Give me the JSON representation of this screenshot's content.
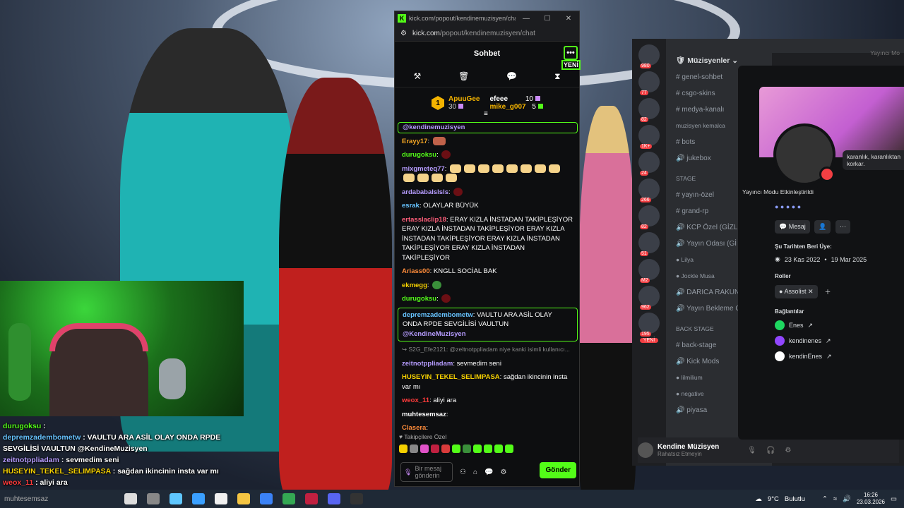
{
  "chat_window": {
    "title": "kick.com/popout/kendinemuzisyen/chat - ...",
    "url_host": "kick.com",
    "url_path": "/popout/kendinemuzisyen/chat",
    "header_title": "Sohbet",
    "new_badge": "YENİ",
    "more_icon": "more-dots-icon",
    "leaderboard": [
      {
        "name": "ApuuGee",
        "value": "30",
        "rank": "1"
      },
      {
        "name": "efeee",
        "value": "10"
      },
      {
        "name": "mike_g007",
        "value": "5"
      }
    ],
    "pinned_mention": "@kendinemuzisyen",
    "messages": [
      {
        "user": "Erayy17",
        "color": "#f5a623",
        "text": "",
        "emote": "img"
      },
      {
        "user": "durugoksu",
        "color": "#53fc18",
        "text": "",
        "emote": "red"
      },
      {
        "user": "mixgmeteq77",
        "color": "#b69cff",
        "text": "",
        "emote": "duck"
      },
      {
        "user": "ardababalslsls",
        "color": "#b69cff",
        "text": "",
        "emote": "red"
      },
      {
        "user": "esrak",
        "color": "#67c3ff",
        "text": "OLAYLAR BÜYÜK",
        "emote": ""
      },
      {
        "user": "ertasslaclip18",
        "color": "#ff5e7a",
        "text": "ERAY KIZLA İNSTADAN TAKİPLEŞİYOR ERAY KIZLA İNSTADAN TAKİPLEŞİYOR ERAY KIZLA İNSTADAN TAKİPLEŞİYOR ERAY KIZLA İNSTADAN TAKİPLEŞİYOR ERAY KIZLA İNSTADAN TAKİPLEŞİYOR",
        "emote": ""
      },
      {
        "user": "Ariass00",
        "color": "#ff8c3a",
        "text": "KNGLL SOCİAL BAK",
        "emote": ""
      },
      {
        "user": "ekmegg",
        "color": "#f5d000",
        "text": "",
        "emote": "pepe"
      },
      {
        "user": "durugoksu",
        "color": "#53fc18",
        "text": "",
        "emote": "red"
      }
    ],
    "highlight_message": {
      "user": "depremzadembometw",
      "text": "VAULTU ARA ASİL OLAY ONDA RPDE SEVGİLİSİ VAULTUN",
      "mention": "@KendineMuzisyen"
    },
    "reply_line": "S2G_Efe2121: @zeltnotppliadam niye kanki isimli kullanıcı...",
    "messages2": [
      {
        "user": "zeitnotppliadam",
        "color": "#b69cff",
        "text": "sevmedim seni"
      },
      {
        "user": "HUSEYIN_TEKEL_SELIMPASA",
        "color": "#f5d000",
        "text": "sağdan ikincinin insta var mı"
      },
      {
        "user": "weox_11",
        "color": "#ff3b3b",
        "text": "aliyi ara"
      },
      {
        "user": "muhtesemsaz",
        "color": "#ffffff",
        "text": ""
      },
      {
        "user": "Clasera",
        "color": "#ff8c3a",
        "text": ""
      }
    ],
    "followers_label": "Takipçilere Özel",
    "input_placeholder": "Bir mesaj gönderin",
    "send_label": "Gönder"
  },
  "stream_overlay": [
    {
      "user": "durugoksu",
      "color": "#53fc18",
      "text": ""
    },
    {
      "user": "depremzadembometw",
      "color": "#67c3ff",
      "text": "VAULTU ARA ASİL OLAY ONDA RPDE SEVGİLİSİ VAULTUN @KendineMuzisyen"
    },
    {
      "user": "zeitnotppliadam",
      "color": "#b69cff",
      "text": "sevmedim seni"
    },
    {
      "user": "HUSEYIN_TEKEL_SELIMPASA",
      "color": "#f5d000",
      "text": "sağdan ikincinin insta var mı"
    },
    {
      "user": "weox_11",
      "color": "#ff3b3b",
      "text": "aliyi ara"
    },
    {
      "user": "muhtesemsaz",
      "color": "#ffffff",
      "text": ""
    }
  ],
  "discord": {
    "server_name": "Müzisyenler",
    "top_hint": "Yayıncı Mo",
    "channels": [
      {
        "name": "genel-sohbet",
        "type": "text"
      },
      {
        "name": "csgo-skins",
        "type": "text"
      },
      {
        "name": "medya-kanalı",
        "type": "text"
      },
      {
        "name": "muzisyen kemalca",
        "type": "sub"
      },
      {
        "name": "bots",
        "type": "text"
      },
      {
        "name": "jukebox",
        "type": "voice"
      },
      {
        "name": "STAGE",
        "type": "cat"
      },
      {
        "name": "yayın-özel",
        "type": "text"
      },
      {
        "name": "grand-rp",
        "type": "text"
      },
      {
        "name": "KCP Özel (GİZL",
        "type": "voice"
      },
      {
        "name": "Yayın Odası (Gİ",
        "type": "voice"
      },
      {
        "name": "Lilya",
        "type": "member"
      },
      {
        "name": "Jockle Musa",
        "type": "member"
      },
      {
        "name": "DARICA RAKUN",
        "type": "voice"
      },
      {
        "name": "Yayın Bekleme O",
        "type": "voice"
      },
      {
        "name": "BACK STAGE",
        "type": "cat"
      },
      {
        "name": "back-stage",
        "type": "text"
      },
      {
        "name": "Kick Mods",
        "type": "voice"
      },
      {
        "name": "lilmilium",
        "type": "member"
      },
      {
        "name": "negative",
        "type": "member"
      },
      {
        "name": "piyasa",
        "type": "voice"
      }
    ],
    "server_badges": [
      "980",
      "77",
      "82",
      "1K+",
      "24",
      "266",
      "82",
      "51",
      "M2",
      "962",
      "195"
    ],
    "yeni_badge": "YENİ",
    "user_name": "Kendine Müzisyen",
    "user_status": "Rahatsız Etmeyin",
    "profile": {
      "bubble": "karanlık, karanlıktan korkar.",
      "tooltip": "Yayıncı Modu Etkinleştirildi",
      "message_btn": "Mesaj",
      "member_since_label": "Şu Tarihten Beri Üye:",
      "since_discord": "23 Kas 2022",
      "since_server": "19 Mar 2025",
      "roles_label": "Roller",
      "role": "Assolist",
      "connections_label": "Bağlantılar",
      "connections": [
        {
          "name": "Enes",
          "color": "#1ed760"
        },
        {
          "name": "kendinenes",
          "color": "#9146ff"
        },
        {
          "name": "kendinEnes",
          "color": "#ffffff"
        }
      ]
    }
  },
  "taskbar": {
    "apps": [
      "search-icon",
      "task-view-icon",
      "copilot-icon",
      "edge-icon",
      "store-icon",
      "explorer-icon",
      "mail-icon",
      "chrome-icon",
      "app-icon",
      "discord-icon",
      "obs-icon"
    ],
    "weather_temp": "9°C",
    "weather_text": "Bulutlu",
    "time": "16:26",
    "date": "23.03.2026"
  }
}
